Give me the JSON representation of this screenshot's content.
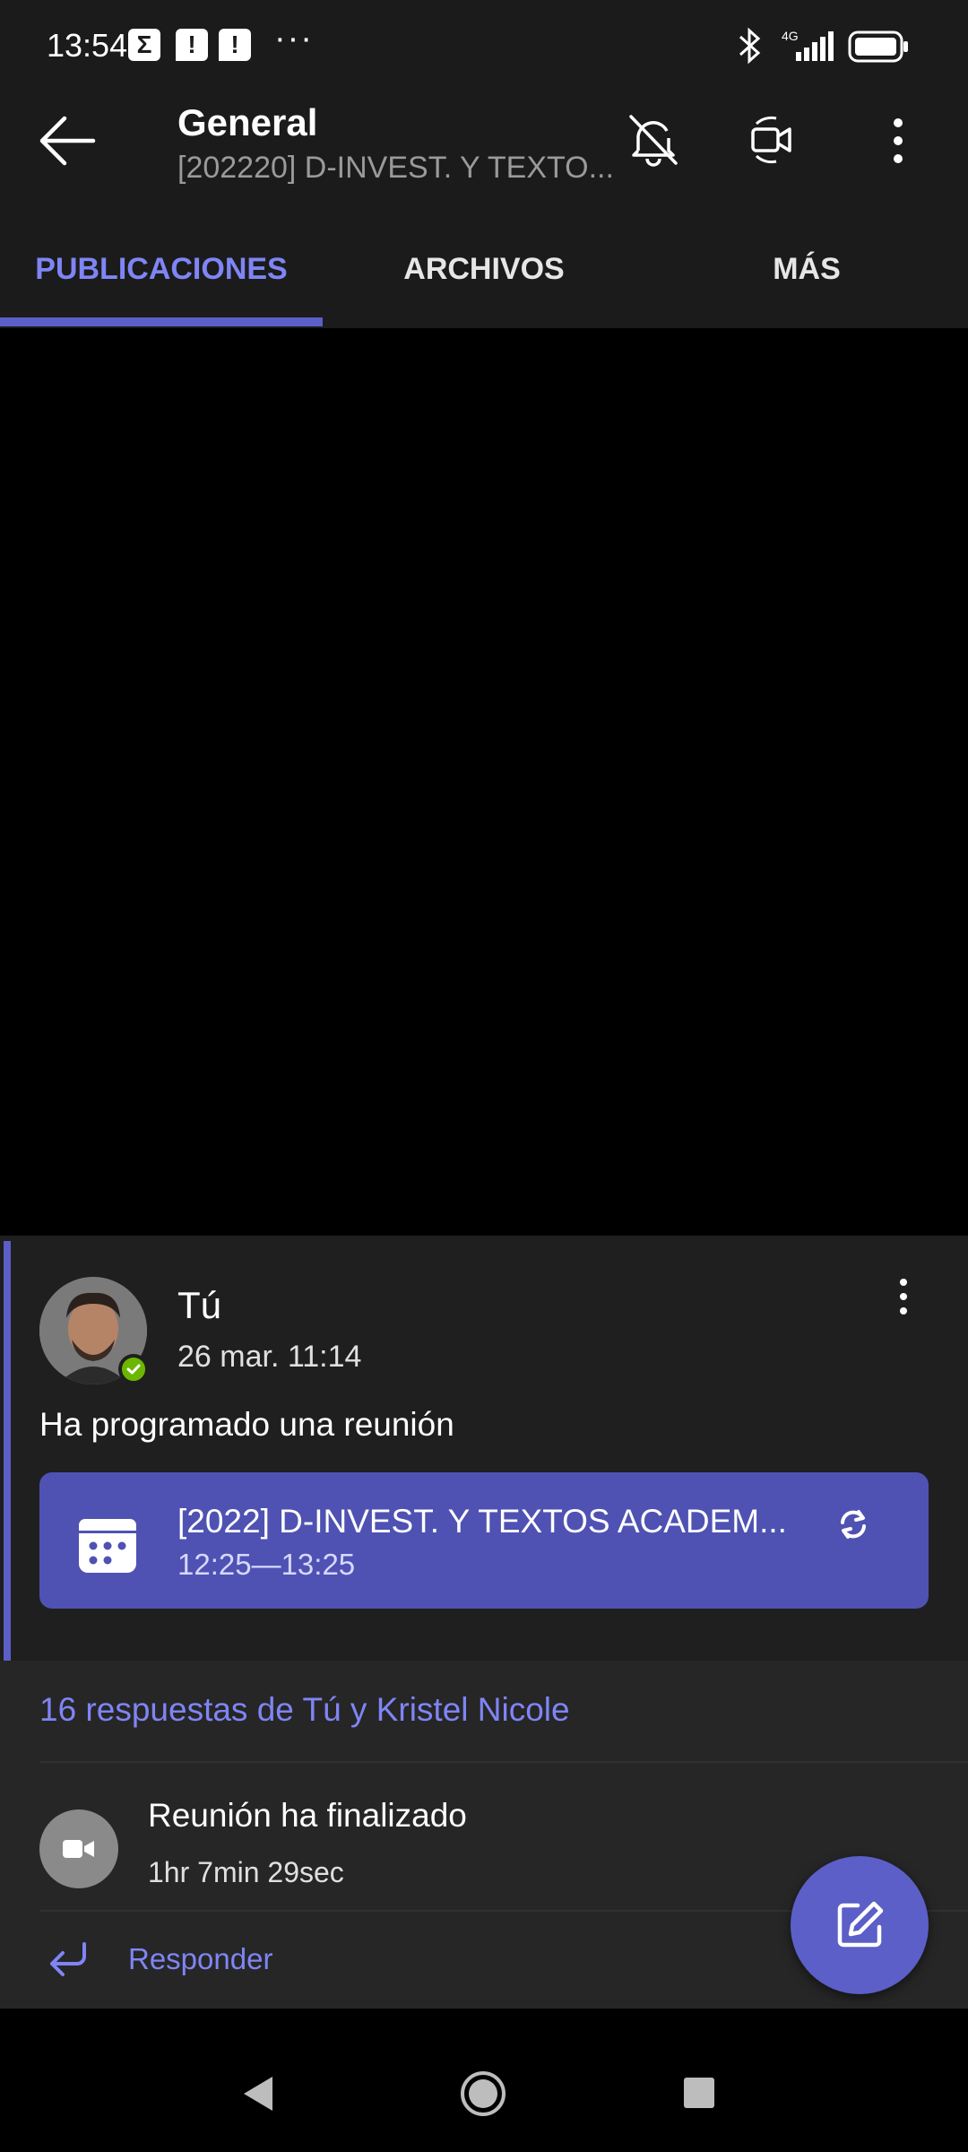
{
  "status_bar": {
    "time": "13:54",
    "notif_sigma": "Σ",
    "notif_alert": "!",
    "overflow": "···",
    "network": "4G"
  },
  "header": {
    "title": "General",
    "subtitle": "[202220] D-INVEST. Y TEXTO..."
  },
  "tabs": [
    {
      "label": "PUBLICACIONES",
      "active": true
    },
    {
      "label": "ARCHIVOS",
      "active": false
    },
    {
      "label": "MÁS",
      "active": false
    }
  ],
  "post": {
    "author": "Tú",
    "time": "26 mar. 11:14",
    "text": "Ha programado una reunión",
    "meeting": {
      "title": "[2022] D-INVEST. Y TEXTOS ACADEM...",
      "time": "12:25—13:25"
    }
  },
  "replies": {
    "summary": "16 respuestas de Tú y Kristel Nicole",
    "ended_title": "Reunión ha finalizado",
    "ended_duration": "1hr 7min 29sec",
    "reply_label": "Responder"
  },
  "colors": {
    "accent": "#5b5fc7",
    "accent_text": "#7f85f5",
    "meeting_card": "#4f52b2",
    "presence_available": "#6bb700"
  }
}
